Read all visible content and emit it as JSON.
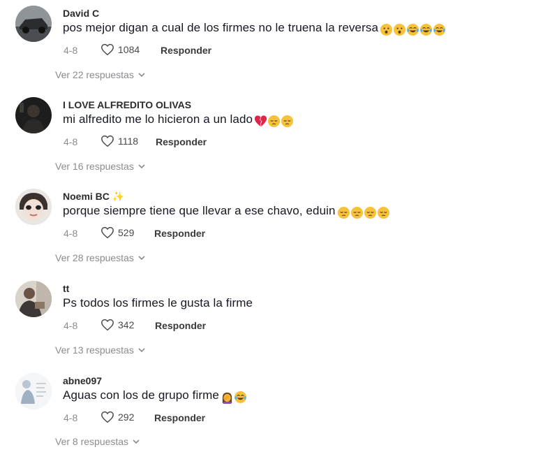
{
  "comments": [
    {
      "username": "David C",
      "text": "pos mejor digan a cual de los firmes no le truena la reversa",
      "emojis": [
        "hushed-face",
        "hushed-face",
        "tears-of-joy",
        "tears-of-joy",
        "tears-of-joy"
      ],
      "date": "4-8",
      "likes": "1084",
      "reply_label": "Responder",
      "view_replies": "Ver 22 respuestas"
    },
    {
      "username": "I LOVE ALFREDITO OLIVAS",
      "text": "mi alfredito me lo hicieron a un lado",
      "emojis": [
        "broken-heart",
        "pensive-face",
        "pensive-face"
      ],
      "date": "4-8",
      "likes": "1118",
      "reply_label": "Responder",
      "view_replies": "Ver 16 respuestas"
    },
    {
      "username": "Noemi BC",
      "username_suffix": "✨",
      "text": "porque siempre tiene que llevar a ese chavo, eduin",
      "emojis": [
        "pensive-face",
        "pensive-face",
        "pensive-face",
        "pensive-face"
      ],
      "date": "4-8",
      "likes": "529",
      "reply_label": "Responder",
      "view_replies": "Ver 28 respuestas"
    },
    {
      "username": "tt",
      "text": "Ps todos los firmes le gusta la firme",
      "emojis": [],
      "date": "4-8",
      "likes": "342",
      "reply_label": "Responder",
      "view_replies": "Ver 13 respuestas"
    },
    {
      "username": "abne097",
      "text": "Aguas con los de grupo firme",
      "emojis": [
        "person-facepalming",
        "tears-of-joy"
      ],
      "date": "4-8",
      "likes": "292",
      "reply_label": "Responder",
      "view_replies": "Ver 8 respuestas"
    }
  ],
  "icons": {
    "like": "heart-outline-icon",
    "expand": "chevron-down-icon"
  },
  "colors": {
    "text": "#161823",
    "secondary": "#8a8b91",
    "emoji_yellow": "#f7c23b"
  }
}
